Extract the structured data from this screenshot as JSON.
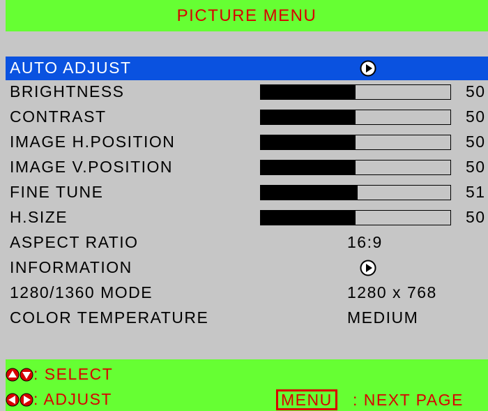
{
  "menu": {
    "title": "PICTURE MENU"
  },
  "items": [
    {
      "label": "AUTO ADJUST",
      "type": "action"
    },
    {
      "label": "BRIGHTNESS",
      "type": "slider",
      "level": 0.5,
      "value": "50"
    },
    {
      "label": "CONTRAST",
      "type": "slider",
      "level": 0.5,
      "value": "50"
    },
    {
      "label": "IMAGE H.POSITION",
      "type": "slider",
      "level": 0.5,
      "value": "50"
    },
    {
      "label": "IMAGE V.POSITION",
      "type": "slider",
      "level": 0.5,
      "value": "50"
    },
    {
      "label": "FINE TUNE",
      "type": "slider",
      "level": 0.51,
      "value": "51"
    },
    {
      "label": "H.SIZE",
      "type": "slider",
      "level": 0.5,
      "value": "50"
    },
    {
      "label": "ASPECT RATIO",
      "type": "text",
      "value": "16:9"
    },
    {
      "label": "INFORMATION",
      "type": "action"
    },
    {
      "label": "1280/1360 MODE",
      "type": "text",
      "value": "1280 x 768"
    },
    {
      "label": "COLOR TEMPERATURE",
      "type": "text",
      "value": "MEDIUM"
    }
  ],
  "footer": {
    "select_hint": ": SELECT",
    "adjust_hint": ": ADJUST",
    "menu_key": "MENU",
    "next_page_hint": ": NEXT PAGE"
  },
  "colors": {
    "header_bg": "#66ff33",
    "header_text": "#d80000",
    "panel_bg": "#c6c6c6",
    "selected_bg": "#0a52e0"
  }
}
